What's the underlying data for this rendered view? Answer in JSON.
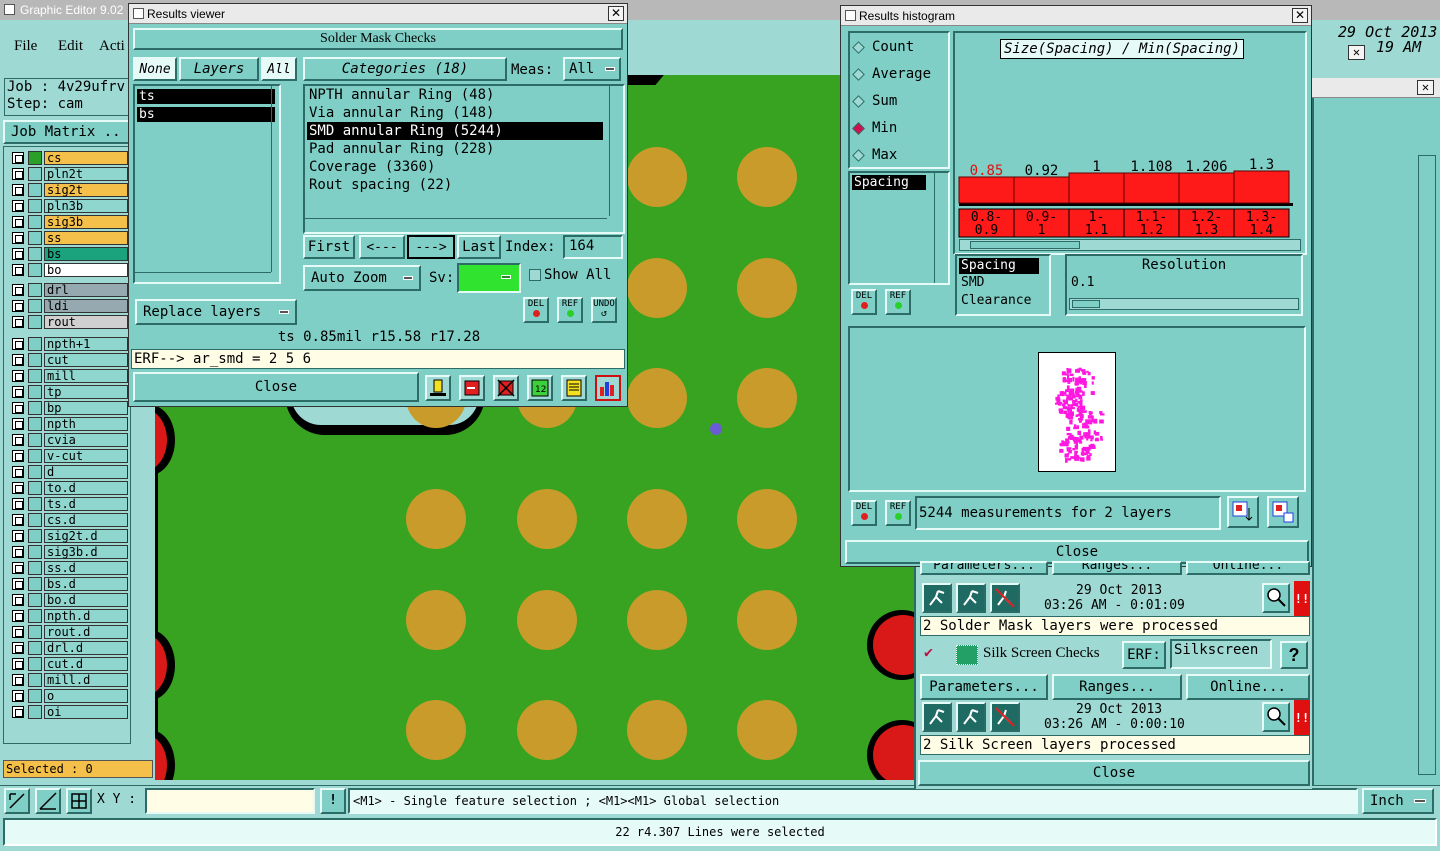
{
  "main": {
    "title": "Graphic Editor 9.02",
    "menu": [
      "File",
      "Edit",
      "Acti"
    ],
    "job_label": "Job : 4v29ufrv",
    "step_label": "Step: cam",
    "job_matrix": "Job Matrix ..",
    "date": "29 Oct 2013",
    "time": "19 AM",
    "selected": "Selected : 0",
    "xy_label": "X Y :",
    "xy_value": "",
    "hint": "<M1> - Single feature selection ; <M1><M1> Global selection",
    "units": "Inch",
    "status": "22 r4.307 Lines were selected",
    "layers": [
      {
        "name": "cs",
        "color": "#f5c04a"
      },
      {
        "name": "pln2t",
        "color": "#8fd6cf"
      },
      {
        "name": "sig2t",
        "color": "#f5c04a"
      },
      {
        "name": "pln3b",
        "color": "#8fd6cf"
      },
      {
        "name": "sig3b",
        "color": "#f5c04a"
      },
      {
        "name": "ss",
        "color": "#f5c04a"
      },
      {
        "name": "bs",
        "color": "#1aa37d"
      },
      {
        "name": "bo",
        "color": "#ffffff"
      },
      {
        "name": "drl",
        "color": "#96a9b0"
      },
      {
        "name": "ldi",
        "color": "#96a9b0"
      },
      {
        "name": "rout",
        "color": "#d0d0d0"
      },
      {
        "name": "npth+1",
        "color": "#8fd6cf"
      },
      {
        "name": "cut",
        "color": "#8fd6cf"
      },
      {
        "name": "mill",
        "color": "#8fd6cf"
      },
      {
        "name": "tp",
        "color": "#8fd6cf"
      },
      {
        "name": "bp",
        "color": "#8fd6cf"
      },
      {
        "name": "npth",
        "color": "#8fd6cf"
      },
      {
        "name": "cvia",
        "color": "#8fd6cf"
      },
      {
        "name": "v-cut",
        "color": "#8fd6cf"
      },
      {
        "name": "d",
        "color": "#8fd6cf"
      },
      {
        "name": "to.d",
        "color": "#8fd6cf"
      },
      {
        "name": "ts.d",
        "color": "#8fd6cf"
      },
      {
        "name": "cs.d",
        "color": "#8fd6cf"
      },
      {
        "name": "sig2t.d",
        "color": "#8fd6cf"
      },
      {
        "name": "sig3b.d",
        "color": "#8fd6cf"
      },
      {
        "name": "ss.d",
        "color": "#8fd6cf"
      },
      {
        "name": "bs.d",
        "color": "#8fd6cf"
      },
      {
        "name": "bo.d",
        "color": "#8fd6cf"
      },
      {
        "name": "npth.d",
        "color": "#8fd6cf"
      },
      {
        "name": "rout.d",
        "color": "#8fd6cf"
      },
      {
        "name": "drl.d",
        "color": "#8fd6cf"
      },
      {
        "name": "cut.d",
        "color": "#8fd6cf"
      },
      {
        "name": "mill.d",
        "color": "#8fd6cf"
      },
      {
        "name": "o",
        "color": "#8fd6cf"
      },
      {
        "name": "oi",
        "color": "#8fd6cf"
      }
    ]
  },
  "results_viewer": {
    "title": "Results viewer",
    "header": "Solder Mask Checks",
    "btn_none": "None",
    "btn_layers": "Layers",
    "btn_all": "All",
    "categories_label": "Categories (18)",
    "meas_label": "Meas:",
    "meas_value": "All",
    "layers": [
      "ts",
      "bs"
    ],
    "categories": [
      "NPTH annular Ring (48)",
      "Via annular Ring (148)",
      "SMD annular Ring (5244)",
      "Pad annular Ring (228)",
      "Coverage (3360)",
      "Rout spacing (22)"
    ],
    "selected_category": 2,
    "first": "First",
    "prev": "<---",
    "next": "--->",
    "last": "Last",
    "index_label": "Index:",
    "index_value": "164",
    "auto_zoom": "Auto Zoom",
    "sv_label": "Sv:",
    "show_all": "Show All",
    "replace_layers": "Replace layers",
    "del": "DEL",
    "ref": "REF",
    "undo": "UNDO",
    "info": "ts 0.85mil  r15.58  r17.28",
    "erf": "ERF--> ar_smd = 2 5 6",
    "close": "Close"
  },
  "histogram": {
    "title": "Results histogram",
    "stats": [
      "Count",
      "Average",
      "Sum",
      "Min",
      "Max"
    ],
    "selected_stat": 3,
    "chart_title": "Size(Spacing) / Min(Spacing)",
    "list": [
      "Spacing"
    ],
    "del": "DEL",
    "ref": "REF",
    "resolution_label": "Resolution",
    "resolution_value": "0.1",
    "meas_types": [
      "Spacing",
      "SMD",
      "Clearance"
    ],
    "summary": "5244 measurements for 2 layers",
    "close": "Close"
  },
  "chart_data": {
    "type": "bar",
    "title": "Size(Spacing) / Min(Spacing)",
    "categories": [
      "0.8-\n0.9",
      "0.9-\n1",
      "1-\n1.1",
      "1.1-\n1.2",
      "1.2-\n1.3",
      "1.3-\n1.4"
    ],
    "category_labels": [
      [
        "0.8-",
        "0.9"
      ],
      [
        "0.9-",
        "1"
      ],
      [
        "1-",
        "1.1"
      ],
      [
        "1.1-",
        "1.2"
      ],
      [
        "1.2-",
        "1.3"
      ],
      [
        "1.3-",
        "1.4"
      ]
    ],
    "value_labels": [
      "0.85",
      "0.92",
      "1",
      "1.108",
      "1.206",
      "1.3"
    ],
    "highlight_label": 0,
    "bar_color": "#ff1a1a"
  },
  "checks": {
    "params_top": "Parameters...",
    "ranges_top": "Ranges...",
    "online_top": "Online...",
    "date1": "29 Oct 2013",
    "time1": "03:26 AM - 0:01:09",
    "msg1": "2 Solder Mask layers were processed",
    "silk_name": "Silk Screen Checks",
    "erf_label": "ERF:",
    "erf_value": "Silkscreen",
    "help": "?",
    "params": "Parameters...",
    "ranges": "Ranges...",
    "online": "Online...",
    "date2": "29 Oct 2013",
    "time2": "03:26 AM - 0:00:10",
    "msg2": "2 Silk Screen layers processed",
    "close": "Close"
  }
}
